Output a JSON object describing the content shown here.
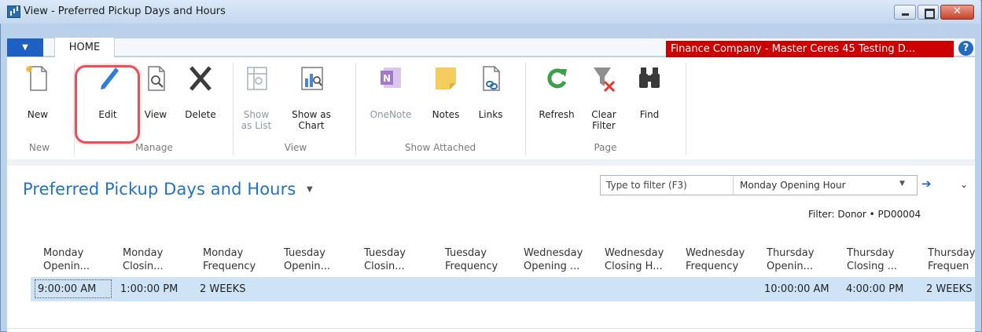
{
  "window": {
    "title": "View - Preferred Pickup Days and Hours"
  },
  "ribbon": {
    "tab": "HOME",
    "company": "Finance Company - Master Ceres 45 Testing D...",
    "buttons": {
      "new": "New",
      "edit": "Edit",
      "view": "View",
      "delete": "Delete",
      "show_as_list": "Show\nas List",
      "show_as_chart": "Show as\nChart",
      "onenote": "OneNote",
      "notes": "Notes",
      "links": "Links",
      "refresh": "Refresh",
      "clear_filter": "Clear\nFilter",
      "find": "Find"
    },
    "groups": {
      "new": "New",
      "manage": "Manage",
      "view": "View",
      "show_attached": "Show Attached",
      "page": "Page"
    }
  },
  "page": {
    "title": "Preferred Pickup Days and Hours",
    "filter_placeholder": "Type to filter (F3)",
    "filter_field": "Monday Opening Hour",
    "filter_info": "Filter: Donor • PD00004"
  },
  "table": {
    "columns": [
      [
        "Monday",
        "Openin..."
      ],
      [
        "Monday",
        "Closin..."
      ],
      [
        "Monday",
        "Frequency"
      ],
      [
        "Tuesday",
        "Openin..."
      ],
      [
        "Tuesday",
        "Closin..."
      ],
      [
        "Tuesday",
        "Frequency"
      ],
      [
        "Wednesday",
        "Opening ..."
      ],
      [
        "Wednesday",
        "Closing H..."
      ],
      [
        "Wednesday",
        "Frequency"
      ],
      [
        "Thursday",
        "Openin..."
      ],
      [
        "Thursday",
        "Closing ..."
      ],
      [
        "Thursday",
        "Frequen"
      ]
    ],
    "row": [
      "9:00:00 AM",
      "1:00:00 PM",
      "2 WEEKS",
      "",
      "",
      "",
      "",
      "",
      "",
      "10:00:00 AM",
      "4:00:00 PM",
      "2 WEEKS"
    ]
  },
  "colors": {
    "accent": "#2072c9",
    "company_bar": "#cc0000",
    "selected_row": "#cfe3f7",
    "highlight": "#e8505b"
  }
}
